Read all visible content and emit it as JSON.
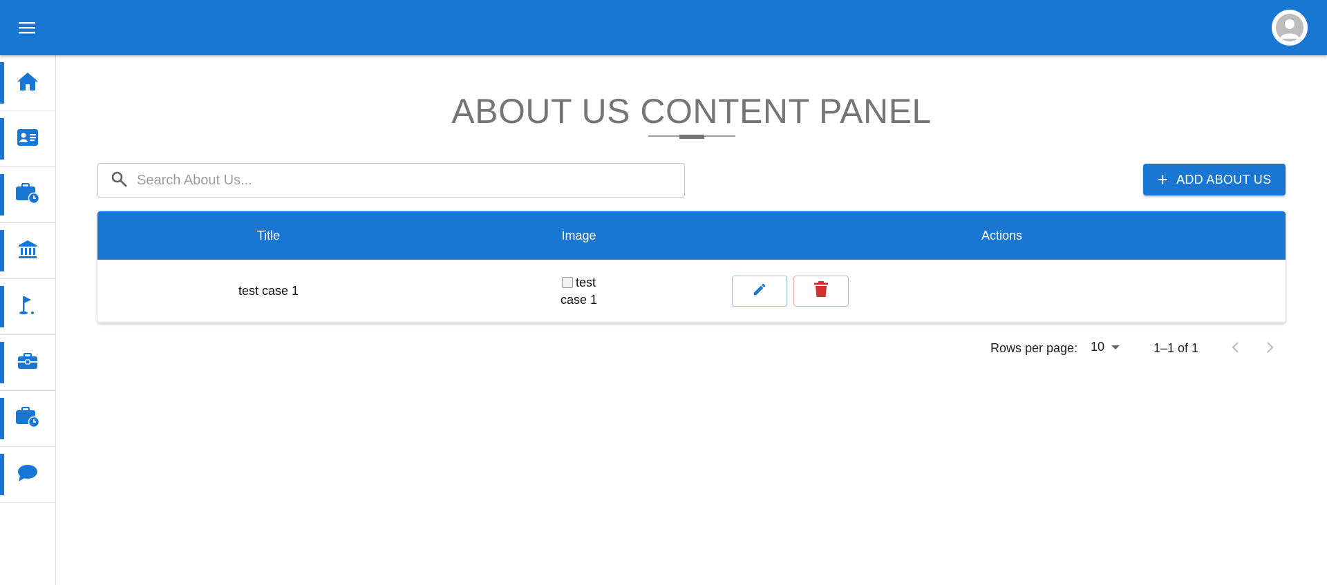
{
  "header": {
    "menu_icon": "hamburger-menu-icon",
    "account_icon": "account-circle-icon"
  },
  "sidebar": {
    "items": [
      {
        "icon": "home-icon"
      },
      {
        "icon": "contact-card-icon"
      },
      {
        "icon": "business-time-icon"
      },
      {
        "icon": "bank-icon"
      },
      {
        "icon": "golf-flag-icon"
      },
      {
        "icon": "briefcase-icon"
      },
      {
        "icon": "business-time-icon"
      },
      {
        "icon": "comment-icon"
      }
    ]
  },
  "page": {
    "title": "ABOUT US CONTENT PANEL"
  },
  "search": {
    "placeholder": "Search About Us...",
    "value": ""
  },
  "toolbar": {
    "add_label": "ADD ABOUT US"
  },
  "table": {
    "columns": [
      "Title",
      "Image",
      "Actions"
    ],
    "rows": [
      {
        "title": "test case 1",
        "image_alt": "test case 1"
      }
    ]
  },
  "pagination": {
    "rows_per_page_label": "Rows per page:",
    "rows_per_page_value": "10",
    "range": "1–1 of 1"
  },
  "colors": {
    "primary": "#1976d2",
    "danger": "#d32f2f",
    "title_gray": "#757575"
  }
}
